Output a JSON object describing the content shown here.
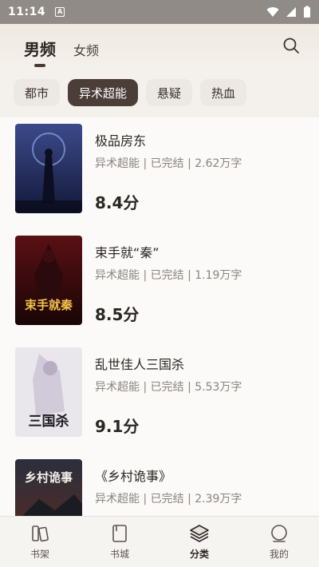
{
  "status_bar": {
    "time": "11:14",
    "notif_letter": "A"
  },
  "header": {
    "tab_male": "男频",
    "tab_female": "女频"
  },
  "chips": [
    "都市",
    "异术超能",
    "悬疑",
    "热血"
  ],
  "books": [
    {
      "title": "极品房东",
      "meta": "异术超能 | 已完结 | 2.62万字",
      "score": "8.4分"
    },
    {
      "title": "束手就“秦”",
      "meta": "异术超能 | 已完结 | 1.19万字",
      "score": "8.5分",
      "cover_text": "束手就秦"
    },
    {
      "title": "乱世佳人三国杀",
      "meta": "异术超能 | 已完结 | 5.53万字",
      "score": "9.1分",
      "cover_text": "三国杀"
    },
    {
      "title": "《乡村诡事》",
      "meta": "异术超能 | 已完结 | 2.39万字",
      "score": "",
      "cover_text": "乡村诡事"
    }
  ],
  "nav": [
    "书架",
    "书城",
    "分类",
    "我的"
  ]
}
